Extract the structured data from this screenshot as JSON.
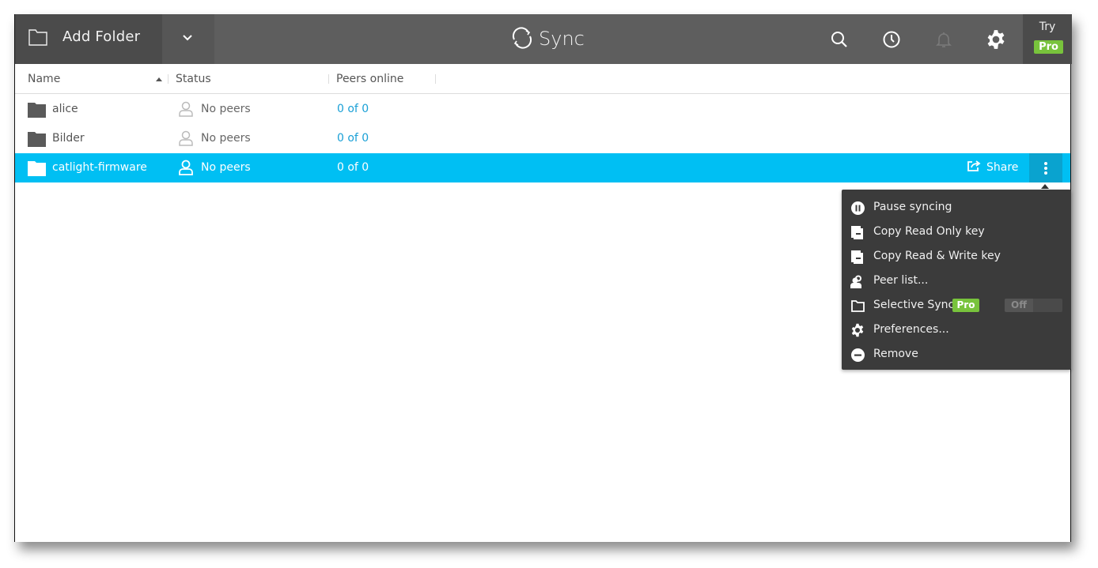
{
  "header": {
    "add_folder_label": "Add Folder",
    "brand": "Sync",
    "icons": [
      "search-icon",
      "history-icon",
      "bell-icon",
      "gear-icon"
    ],
    "try_label": "Try",
    "pro_label": "Pro"
  },
  "table": {
    "columns": [
      {
        "label": "Name",
        "sort": "ascending"
      },
      {
        "label": "Status"
      },
      {
        "label": "Peers online"
      }
    ],
    "rows": [
      {
        "name": "alice",
        "status": "No peers",
        "peers": "0 of 0",
        "selected": false
      },
      {
        "name": "Bilder",
        "status": "No peers",
        "peers": "0 of 0",
        "selected": false
      },
      {
        "name": "catlight-firmware",
        "status": "No peers",
        "peers": "0 of 0",
        "selected": true
      }
    ],
    "share_label": "Share"
  },
  "menu": {
    "items": [
      {
        "label": "Pause syncing",
        "icon": "pause-icon"
      },
      {
        "label": "Copy Read Only key",
        "icon": "copy-icon"
      },
      {
        "label": "Copy Read & Write key",
        "icon": "copy-icon"
      },
      {
        "label": "Peer list...",
        "icon": "peers-icon"
      },
      {
        "label": "Selective Sync",
        "icon": "folder-icon",
        "badge": "Pro",
        "toggle": "Off"
      },
      {
        "label": "Preferences...",
        "icon": "gear-icon"
      },
      {
        "label": "Remove",
        "icon": "remove-icon"
      }
    ]
  },
  "colors": {
    "topbar": "#5e5e5e",
    "selected_row": "#00bff3",
    "link": "#1aa0d6",
    "pro_badge": "#78c33c",
    "menu_bg": "#3b3b3b"
  }
}
